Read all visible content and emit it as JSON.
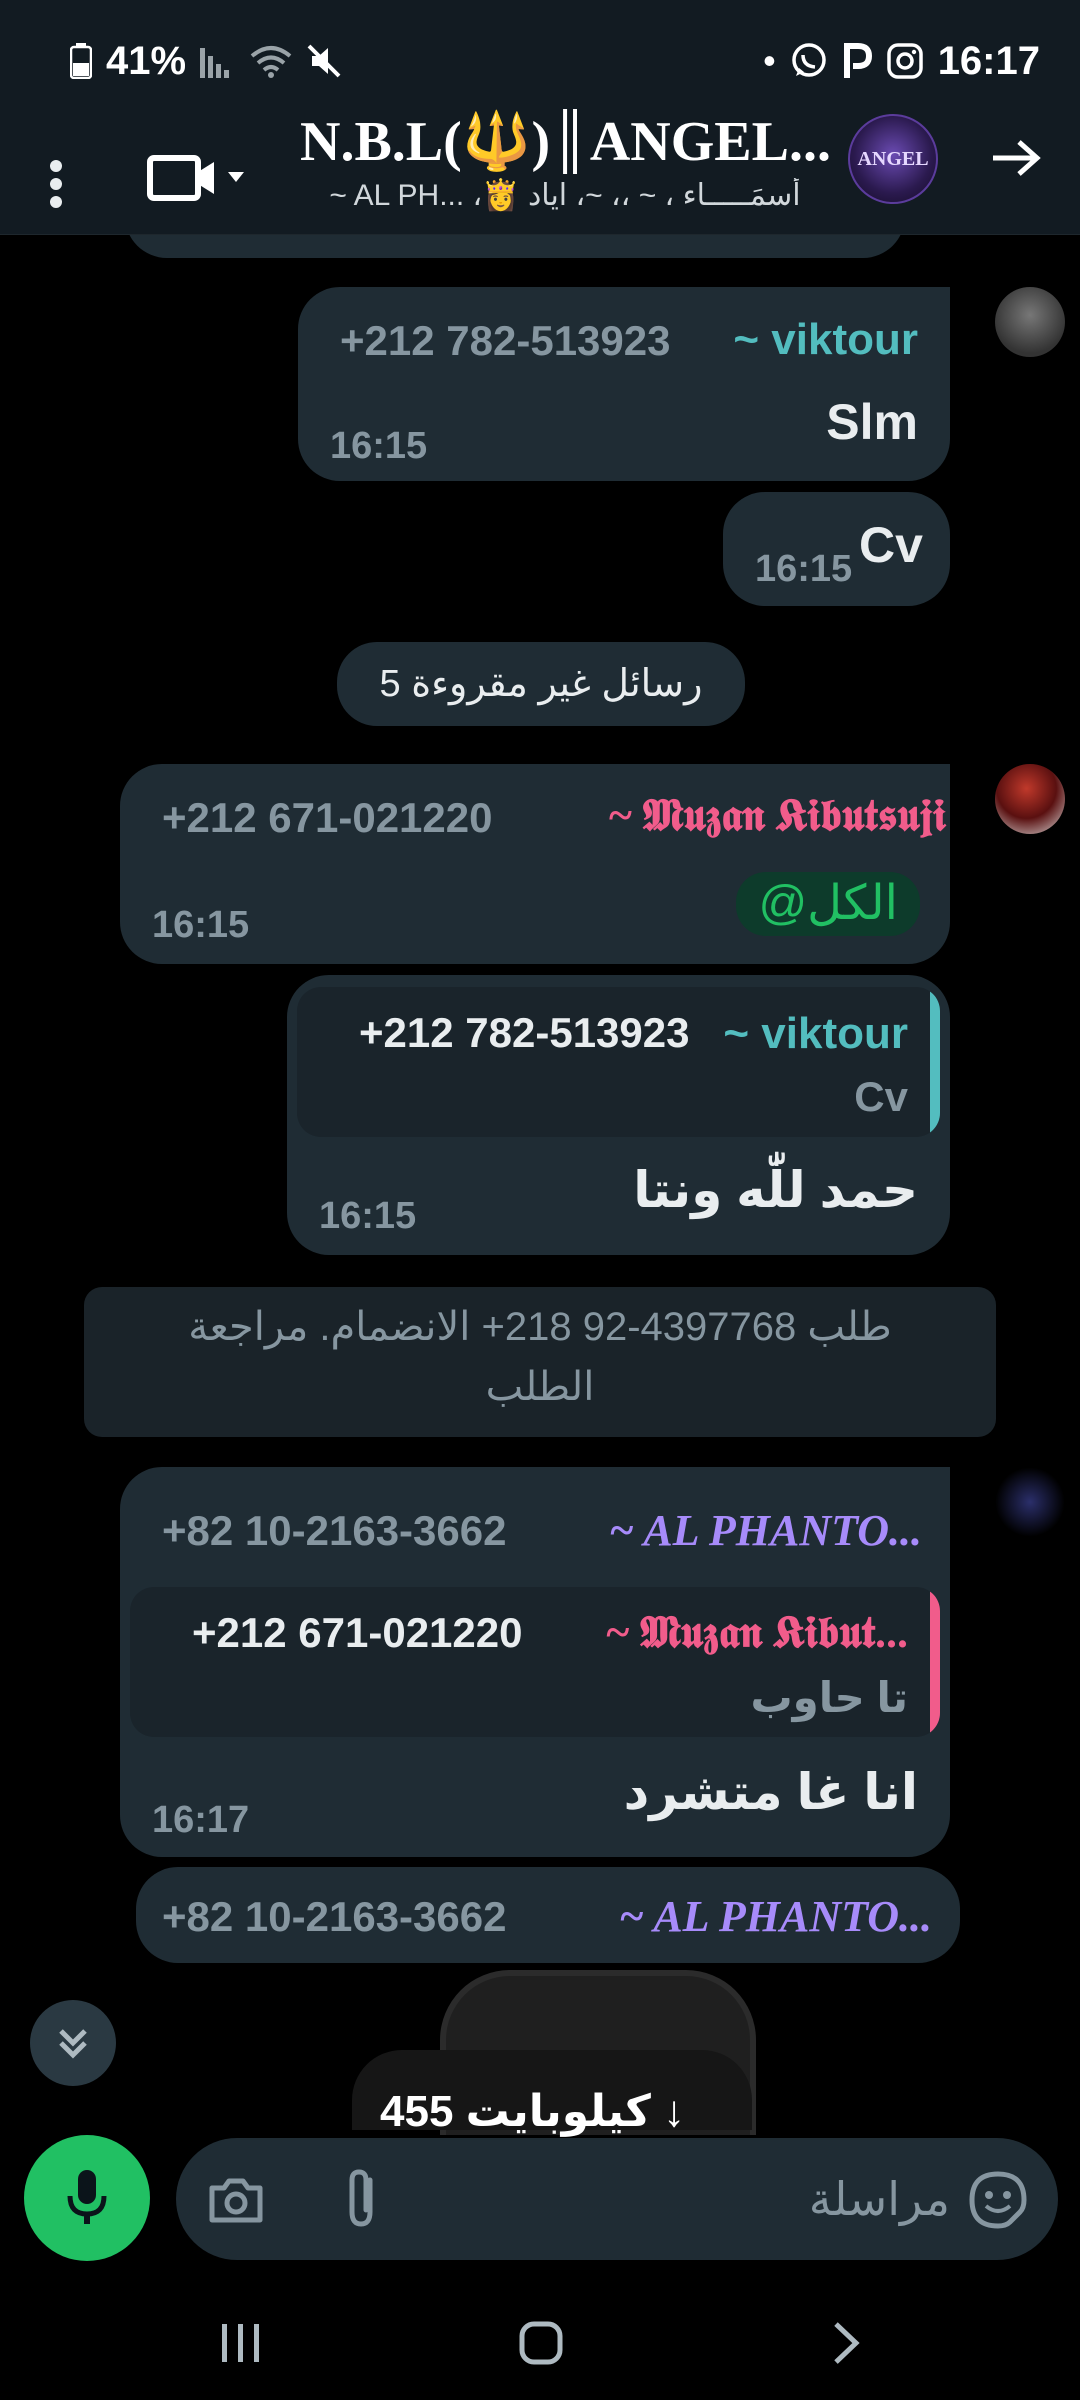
{
  "status_bar": {
    "battery": "41%",
    "time": "16:17",
    "icons": [
      "battery-icon",
      "signal-icon",
      "wifi-icon",
      "mute-icon",
      "dot-icon",
      "whatsapp-icon",
      "p-icon",
      "instagram-icon"
    ]
  },
  "header": {
    "title": "N.B.L(🔱)║ANGEL...",
    "subtitle": "~ AL PH... ،👸 أسمَـــــاء ، ~ ،، ~، اياد",
    "avatar_text": "ANGEL",
    "icons": [
      "more-vertical-icon",
      "video-call-icon",
      "chevron-down-icon",
      "forward-arrow-icon"
    ]
  },
  "messages": [
    {
      "sender": "~ viktour",
      "phone": "+212 782-513923",
      "text": "Slm",
      "time": "16:15",
      "sender_color": "#53bdbf"
    },
    {
      "text": "Cv",
      "time": "16:15"
    },
    {
      "sender": "~ 𝕸𝖚𝖟𝖆𝖓 𝕶𝖎𝖇𝖚𝖙𝖘𝖚𝖏𝖎",
      "phone": "+212 671-021220",
      "mention": "@الكل",
      "time": "16:15",
      "sender_color": "#f15c8b"
    },
    {
      "quote_sender": "~ viktour",
      "quote_phone": "+212 782-513923",
      "quote_text": "Cv",
      "text": "حمد للّٰه ونتا",
      "time": "16:15",
      "quote_color": "#53bdbf"
    },
    {
      "sender": "~ AL PHANTO...",
      "phone": "+82 10-2163-3662",
      "quote_sender": "~ 𝕸𝖚𝖟𝖆𝖓 𝕶𝖎𝖇𝖚𝖙...",
      "quote_phone": "+212 671-021220",
      "quote_text": "تا حاوب",
      "text": "انا غا متشرد",
      "time": "16:17",
      "sender_color": "#a78bfa",
      "quote_color": "#f15c8b"
    },
    {
      "sender": "~ AL PHANTO...",
      "phone": "+82 10-2163-3662",
      "sender_color": "#a78bfa"
    }
  ],
  "unread_pill": "5 رسائل غير مقروءة",
  "join_request": {
    "line1": "طلب 4397768-92 218+ الانضمام. مراجعة",
    "line2": "الطلب"
  },
  "download": {
    "label": "455 كيلوبايت ↓"
  },
  "input_bar": {
    "placeholder": "مراسلة",
    "icons": [
      "mic-icon",
      "camera-icon",
      "attach-icon",
      "sticker-icon"
    ]
  },
  "navbar": {
    "icons": [
      "recent-apps-icon",
      "home-icon",
      "back-icon"
    ]
  },
  "colors": {
    "accent_green": "#21c063",
    "bubble": "#1f2c34",
    "header_bg": "#121b22"
  }
}
